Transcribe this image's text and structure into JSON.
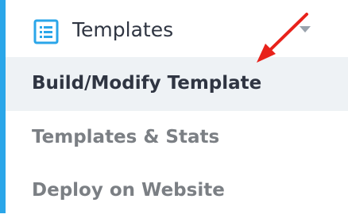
{
  "menu": {
    "header": {
      "icon": "list-icon",
      "label": "Templates",
      "caret_icon": "caret-down-icon"
    },
    "items": [
      {
        "label": "Build/Modify Template",
        "active": true
      },
      {
        "label": "Templates & Stats",
        "active": false
      },
      {
        "label": "Deploy on Website",
        "active": false
      }
    ]
  },
  "annotation": {
    "icon": "red-arrow-icon",
    "color": "#e8221b"
  },
  "colors": {
    "accent": "#2aa6e9",
    "active_item_background": "#eef2f5",
    "active_text": "#2f3542",
    "inactive_text": "#7b7f84"
  }
}
